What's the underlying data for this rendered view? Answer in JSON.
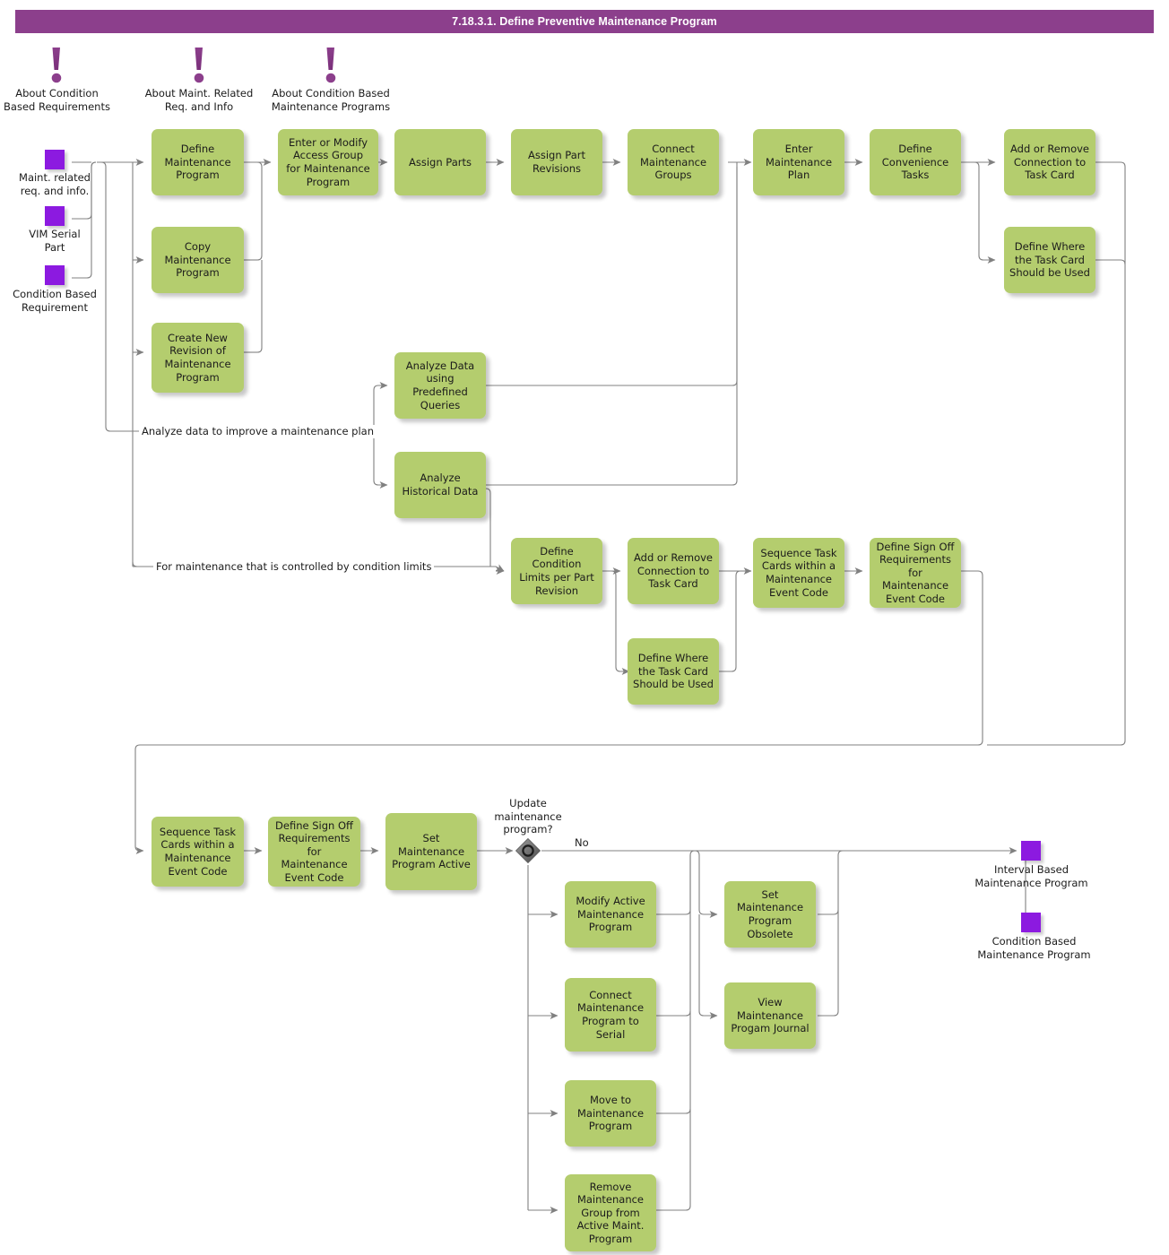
{
  "header": {
    "title": "7.18.3.1. Define Preventive Maintenance Program",
    "bar_color": "#8c3f8c"
  },
  "colors": {
    "process_fill": "#b4cd6e",
    "terminal_fill": "#8c1ae0",
    "connector": "#808080",
    "text": "#1b1b1b"
  },
  "info_markers": [
    {
      "id": "info-condition-based-requirements",
      "label": "About Condition\nBased Requirements"
    },
    {
      "id": "info-maint-related-req",
      "label": "About Maint. Related\nReq. and Info"
    },
    {
      "id": "info-condition-based-programs",
      "label": "About Condition Based\nMaintenance Programs"
    }
  ],
  "input_terminals": [
    {
      "id": "input-maint-related-req",
      "label": "Maint. related\nreq. and info."
    },
    {
      "id": "input-vim-serial-part",
      "label": "VIM Serial\nPart"
    },
    {
      "id": "input-condition-based-requirement",
      "label": "Condition Based\nRequirement"
    }
  ],
  "output_terminals": [
    {
      "id": "output-interval-based",
      "label": "Interval Based\nMaintenance Program"
    },
    {
      "id": "output-condition-based",
      "label": "Condition Based\nMaintenance Program"
    }
  ],
  "gateway": {
    "id": "gateway-update-maintenance-program",
    "question": "Update\nmaintenance\nprogram?",
    "no_label": "No"
  },
  "edge_labels": [
    {
      "id": "edge-analyze-data",
      "text": "Analyze data to improve a maintenance plan"
    },
    {
      "id": "edge-condition-limits",
      "text": "For maintenance that is controlled by condition limits"
    }
  ],
  "nodes": [
    {
      "id": "define-maintenance-program",
      "label": "Define\nMaintenance\nProgram"
    },
    {
      "id": "copy-maintenance-program",
      "label": "Copy\nMaintenance\nProgram"
    },
    {
      "id": "create-new-revision-of-maint-program",
      "label": "Create New\nRevision of\nMaintenance\nProgram"
    },
    {
      "id": "enter-or-modify-access-group",
      "label": "Enter or Modify\nAccess Group\nfor Maintenance\nProgram"
    },
    {
      "id": "assign-parts",
      "label": "Assign Parts"
    },
    {
      "id": "assign-part-revisions",
      "label": "Assign Part\nRevisions"
    },
    {
      "id": "connect-maintenance-groups",
      "label": "Connect\nMaintenance\nGroups"
    },
    {
      "id": "enter-maintenance-plan",
      "label": "Enter\nMaintenance\nPlan"
    },
    {
      "id": "define-convenience-tasks",
      "label": "Define\nConvenience\nTasks"
    },
    {
      "id": "add-or-remove-connection-to-task-card-top",
      "label": "Add or Remove\nConnection to\nTask Card"
    },
    {
      "id": "define-where-task-card-used-top",
      "label": "Define Where\nthe Task Card\nShould be Used"
    },
    {
      "id": "analyze-data-using-predefined-queries",
      "label": "Analyze Data\nusing Predefined\nQueries"
    },
    {
      "id": "analyze-historical-data",
      "label": "Analyze\nHistorical Data"
    },
    {
      "id": "define-condition-limits-per-part-revision",
      "label": "Define Condition\nLimits per Part\nRevision"
    },
    {
      "id": "add-or-remove-connection-to-task-card-mid",
      "label": "Add or Remove\nConnection to\nTask Card"
    },
    {
      "id": "define-where-task-card-used-mid",
      "label": "Define Where\nthe Task Card\nShould be Used"
    },
    {
      "id": "sequence-task-cards-mid",
      "label": "Sequence Task\nCards within a\nMaintenance\nEvent Code"
    },
    {
      "id": "define-sign-off-requirements-mid",
      "label": "Define Sign Off\nRequirements for\nMaintenance\nEvent Code"
    },
    {
      "id": "sequence-task-cards-bottom",
      "label": "Sequence Task\nCards within a\nMaintenance\nEvent Code"
    },
    {
      "id": "define-sign-off-requirements-bottom",
      "label": "Define Sign Off\nRequirements for\nMaintenance\nEvent Code"
    },
    {
      "id": "set-maintenance-program-active",
      "label": "Set Maintenance\nProgram Active"
    },
    {
      "id": "modify-active-maintenance-program",
      "label": "Modify Active\nMaintenance\nProgram"
    },
    {
      "id": "connect-maintenance-program-to-serial",
      "label": "Connect\nMaintenance\nProgram to\nSerial"
    },
    {
      "id": "move-to-maintenance-program",
      "label": "Move to\nMaintenance\nProgram"
    },
    {
      "id": "remove-maintenance-group-from-active",
      "label": "Remove\nMaintenance\nGroup from\nActive Maint.\nProgram"
    },
    {
      "id": "set-maintenance-program-obsolete",
      "label": "Set Maintenance\nProgram\nObsolete"
    },
    {
      "id": "view-maintenance-program-journal",
      "label": "View\nMaintenance\nProgam Journal"
    }
  ]
}
